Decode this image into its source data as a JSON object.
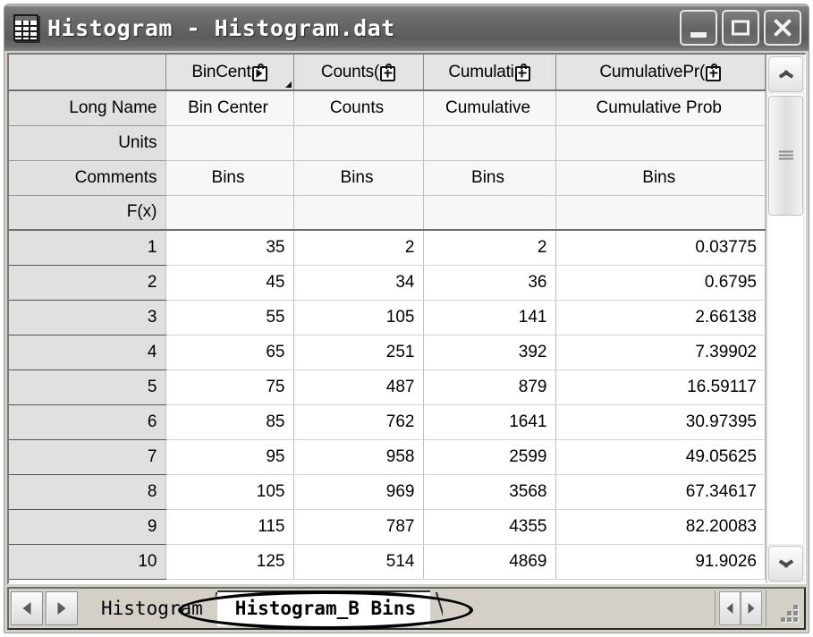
{
  "window": {
    "title": "Histogram - Histogram.dat",
    "icon": "worksheet-grid-icon",
    "minimize_label": "",
    "maximize_label": "",
    "close_label": ""
  },
  "worksheet": {
    "row_header_labels": [
      "Long Name",
      "Units",
      "Comments",
      "F(x)"
    ],
    "columns": [
      {
        "header_text": "BinCent",
        "header_icon": "lock-play-icon",
        "long_name": "Bin Center",
        "units": "",
        "comments": "Bins",
        "fx": ""
      },
      {
        "header_text": "Counts(",
        "header_icon": "lock-plus-icon",
        "long_name": "Counts",
        "units": "",
        "comments": "Bins",
        "fx": ""
      },
      {
        "header_text": "Cumulati",
        "header_icon": "lock-plus-icon",
        "long_name": "Cumulative",
        "units": "",
        "comments": "Bins",
        "fx": ""
      },
      {
        "header_text": "CumulativePr(",
        "header_icon": "lock-plus-icon",
        "long_name": "Cumulative Prob",
        "units": "",
        "comments": "Bins",
        "fx": ""
      }
    ],
    "rows": [
      {
        "index": "1",
        "cells": [
          "35",
          "2",
          "2",
          "0.03775"
        ]
      },
      {
        "index": "2",
        "cells": [
          "45",
          "34",
          "36",
          "0.6795"
        ]
      },
      {
        "index": "3",
        "cells": [
          "55",
          "105",
          "141",
          "2.66138"
        ]
      },
      {
        "index": "4",
        "cells": [
          "65",
          "251",
          "392",
          "7.39902"
        ]
      },
      {
        "index": "5",
        "cells": [
          "75",
          "487",
          "879",
          "16.59117"
        ]
      },
      {
        "index": "6",
        "cells": [
          "85",
          "762",
          "1641",
          "30.97395"
        ]
      },
      {
        "index": "7",
        "cells": [
          "95",
          "958",
          "2599",
          "49.05625"
        ]
      },
      {
        "index": "8",
        "cells": [
          "105",
          "969",
          "3568",
          "67.34617"
        ]
      },
      {
        "index": "9",
        "cells": [
          "115",
          "787",
          "4355",
          "82.20083"
        ]
      },
      {
        "index": "10",
        "cells": [
          "125",
          "514",
          "4869",
          "91.9026"
        ]
      }
    ]
  },
  "tabbar": {
    "prev_label": "",
    "next_label": "",
    "tabs": [
      {
        "label": "Histogram",
        "active": false
      },
      {
        "label": "Histogram_B Bins",
        "active": true
      }
    ]
  },
  "annotation": {
    "shape": "ellipse",
    "target": "Histogram_B Bins",
    "color": "#000000"
  }
}
